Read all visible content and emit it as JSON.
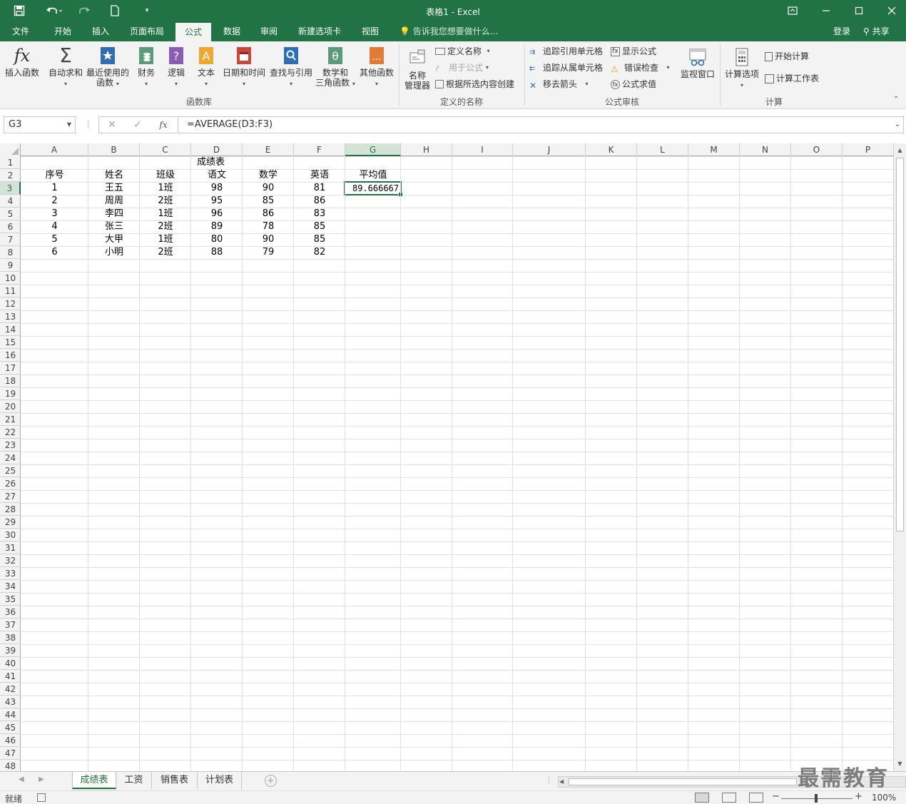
{
  "titlebar": {
    "title": "表格1 - Excel"
  },
  "tabs": [
    {
      "label": "文件",
      "active": false
    },
    {
      "label": "开始",
      "active": false
    },
    {
      "label": "插入",
      "active": false
    },
    {
      "label": "页面布局",
      "active": false
    },
    {
      "label": "公式",
      "active": true
    },
    {
      "label": "数据",
      "active": false
    },
    {
      "label": "审阅",
      "active": false
    },
    {
      "label": "新建选项卡",
      "active": false
    },
    {
      "label": "视图",
      "active": false
    }
  ],
  "tell_me": "告诉我您想要做什么...",
  "account": {
    "login": "登录",
    "share": "共享"
  },
  "ribbon": {
    "function_library": {
      "group_label": "函数库",
      "insert_function": "插入函数",
      "autosum": "自动求和",
      "recent_l1": "最近使用的",
      "recent_l2": "函数",
      "financial": "财务",
      "logical": "逻辑",
      "text": "文本",
      "datetime": "日期和时间",
      "lookup": "查找与引用",
      "math_l1": "数学和",
      "math_l2": "三角函数",
      "more": "其他函数"
    },
    "defined_names": {
      "group_label": "定义的名称",
      "manager_l1": "名称",
      "manager_l2": "管理器",
      "define_name": "定义名称",
      "use_in_formula": "用于公式",
      "create_from_selection": "根据所选内容创建"
    },
    "formula_auditing": {
      "group_label": "公式审核",
      "trace_precedents": "追踪引用单元格",
      "trace_dependents": "追踪从属单元格",
      "remove_arrows": "移去箭头",
      "show_formulas": "显示公式",
      "error_checking": "错误检查",
      "evaluate_formula": "公式求值",
      "watch_window": "监视窗口"
    },
    "calculation": {
      "group_label": "计算",
      "options": "计算选项",
      "calc_now": "开始计算",
      "calc_sheet": "计算工作表"
    }
  },
  "formula_bar": {
    "name_box": "G3",
    "formula": "=AVERAGE(D3:F3)"
  },
  "columns": [
    "A",
    "B",
    "C",
    "D",
    "E",
    "F",
    "G",
    "H",
    "I",
    "J",
    "K",
    "L",
    "M",
    "N",
    "O",
    "P"
  ],
  "selected_column": "G",
  "selected_row": 3,
  "rows_visible": 48,
  "sheet": {
    "title": "成绩表",
    "headers": [
      "序号",
      "姓名",
      "班级",
      "语文",
      "数学",
      "英语",
      "平均值"
    ],
    "rows": [
      [
        "1",
        "王五",
        "1班",
        "98",
        "90",
        "81",
        "89.666667"
      ],
      [
        "2",
        "周周",
        "2班",
        "95",
        "85",
        "86",
        ""
      ],
      [
        "3",
        "李四",
        "1班",
        "96",
        "86",
        "83",
        ""
      ],
      [
        "4",
        "张三",
        "2班",
        "89",
        "78",
        "85",
        ""
      ],
      [
        "5",
        "大甲",
        "1班",
        "80",
        "90",
        "85",
        ""
      ],
      [
        "6",
        "小明",
        "2班",
        "88",
        "79",
        "82",
        ""
      ]
    ]
  },
  "sheet_tabs": [
    {
      "label": "成绩表",
      "active": true
    },
    {
      "label": "工资",
      "active": false
    },
    {
      "label": "销售表",
      "active": false
    },
    {
      "label": "计划表",
      "active": false
    }
  ],
  "watermark": "最需教育",
  "status": {
    "ready": "就绪",
    "zoom": "100%"
  },
  "colors": {
    "accent": "#217346",
    "ribbon_bg": "#f3f3f3"
  }
}
